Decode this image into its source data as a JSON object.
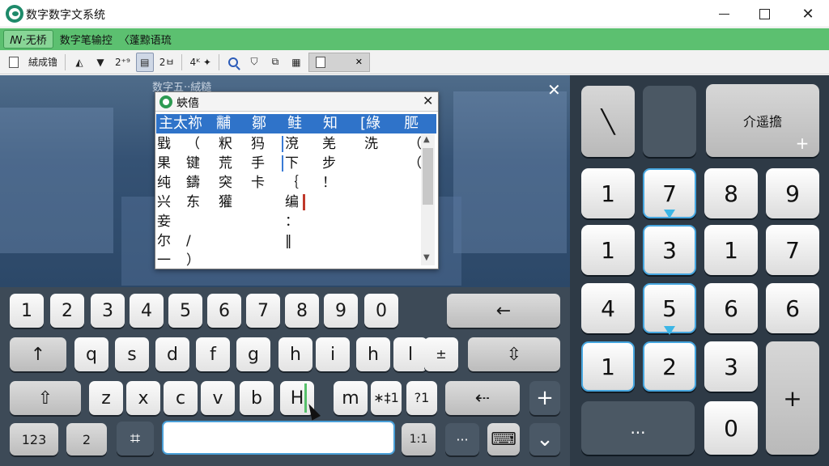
{
  "window": {
    "title": "数字数字文系统"
  },
  "menu": {
    "home": "ꟿ·无桥",
    "items": [
      "数字笔输控",
      "〈蓬黥语琉"
    ]
  },
  "toolbar": {
    "item1": "絨成镥",
    "item2": "2⁺⁹",
    "item3": "2ㅂ",
    "item4": "4ᴷ ✦"
  },
  "caption": "数字五··絨糙",
  "popup": {
    "title": "蛺僖",
    "candidates": [
      "主太祢",
      "黼",
      "鄒",
      "鲑",
      "知",
      "[綠",
      "䏘"
    ],
    "grid": [
      [
        "戥",
        "（",
        "粎",
        "犸",
        "渷",
        "羌",
        "洗",
        "（"
      ],
      [
        "果",
        "键",
        "荒",
        "手",
        "下",
        "步",
        "",
        "（"
      ],
      [
        "纯",
        "鑄",
        "突",
        "卡",
        "｛",
        "！",
        "",
        ""
      ],
      [
        "兴",
        "东",
        "獾",
        "",
        "编",
        "",
        "",
        ""
      ],
      [
        "妾",
        "",
        "",
        "",
        "：",
        "",
        "",
        ""
      ],
      [
        "尔",
        "/",
        "",
        "",
        "‖",
        "",
        "",
        ""
      ],
      [
        "⼀",
        "）",
        "",
        "",
        "",
        "",
        "",
        ""
      ]
    ]
  },
  "keyboard": {
    "row1": [
      "1",
      "2",
      "3",
      "4",
      "5",
      "6",
      "7",
      "8",
      "9",
      "0"
    ],
    "row2": [
      "q",
      "s",
      "d",
      "f",
      "g",
      "h",
      "i",
      "h",
      "l"
    ],
    "row3": [
      "z",
      "x",
      "c",
      "v",
      "b",
      "H",
      "m"
    ],
    "row4_123": "123",
    "row4_2": "2",
    "special1": "←",
    "special2": "∗‡1",
    "special3": "?1",
    "special4": "⇠",
    "special5": "1:1",
    "special6": "···",
    "pm": "±",
    "plus": "+",
    "down": "⌄"
  },
  "numpad": {
    "top_text": "介遥擔",
    "top_plus": "+",
    "rows": [
      [
        "1",
        "7",
        "8",
        "9"
      ],
      [
        "1",
        "3",
        "1",
        "7"
      ],
      [
        "4",
        "5",
        "6",
        "6"
      ],
      [
        "1",
        "2",
        "3"
      ]
    ],
    "bottom_left": "...",
    "bottom_zero": "0",
    "big_plus": "+"
  }
}
